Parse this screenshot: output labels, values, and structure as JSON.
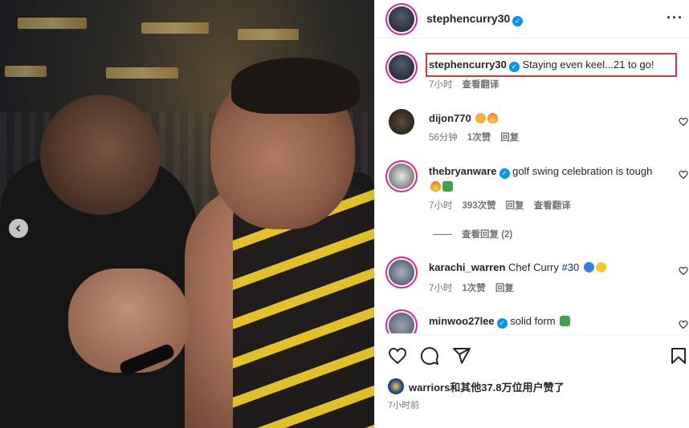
{
  "post": {
    "author": "stephencurry30",
    "caption": "Staying even keel...21 to go!",
    "caption_time": "7小时",
    "caption_translate": "查看翻译"
  },
  "comments": [
    {
      "user": "dijon770",
      "text": "",
      "emojis": [
        "clap",
        "fire"
      ],
      "time": "56分钟",
      "likes": "1次赞",
      "reply": "回复"
    },
    {
      "user": "thebryanware",
      "verified": true,
      "text": "golf swing celebration is tough",
      "emojis": [
        "fire",
        "golf"
      ],
      "time": "7小时",
      "likes": "393次赞",
      "reply": "回复",
      "translate": "查看翻译",
      "view_replies": "查看回复 (2)"
    },
    {
      "user": "karachi_warren",
      "text": "Chef Curry ",
      "hashtag": "#30",
      "emojis": [
        "blue-heart",
        "yellow-heart"
      ],
      "time": "7小时",
      "likes": "1次赞",
      "reply": "回复"
    },
    {
      "user": "minwoo27lee",
      "verified": true,
      "text": "solid form",
      "emojis": [
        "golf"
      ]
    }
  ],
  "footer": {
    "likes_text": "warriors和其他37.8万位用户赞了",
    "time": "7小时前"
  },
  "colors": {
    "verified": "#0095f6",
    "highlight_border": "#d9343f",
    "meta_text": "#737373"
  },
  "icons": [
    "heart-icon",
    "comment-icon",
    "share-icon",
    "bookmark-icon",
    "more-icon",
    "chevron-left-icon",
    "verified-icon"
  ]
}
